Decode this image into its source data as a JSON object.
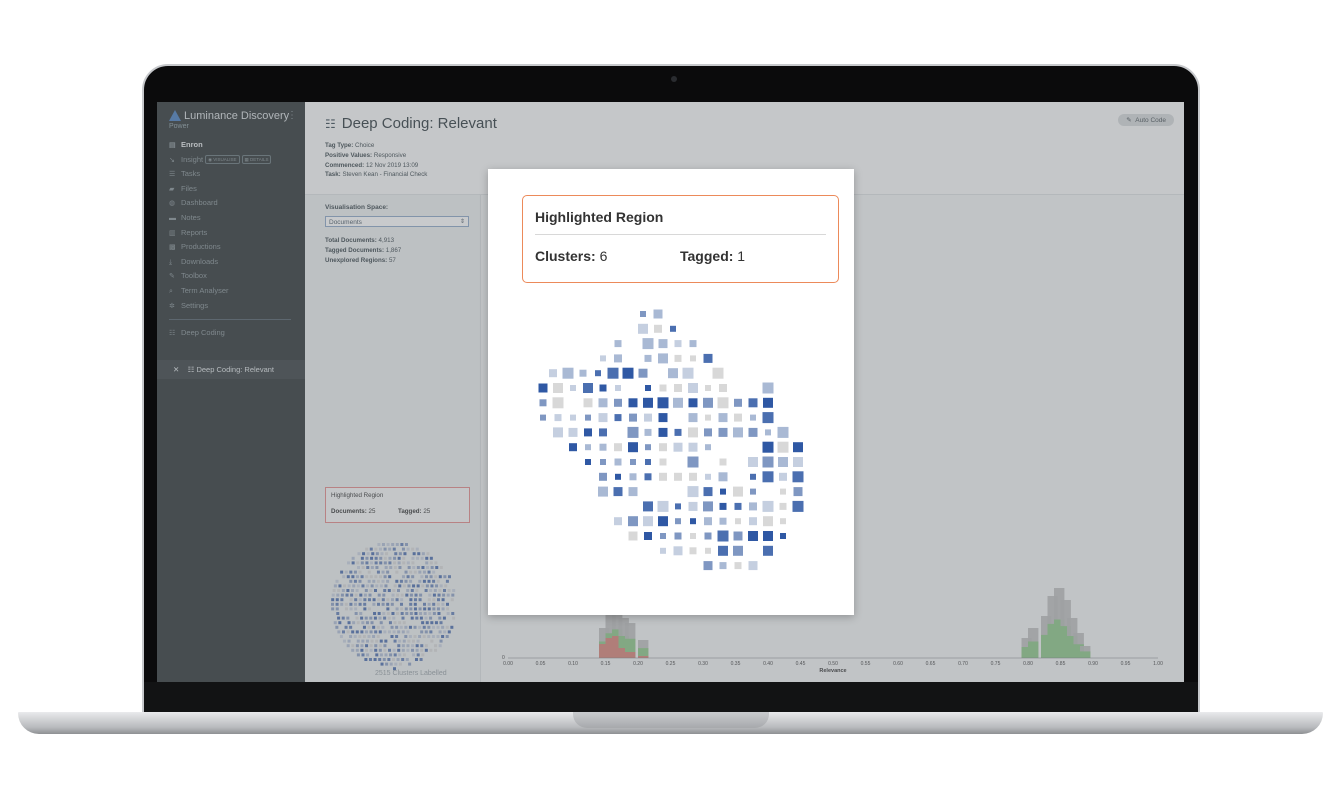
{
  "app": {
    "brand_name": "Luminance Discovery",
    "brand_sub": "Power"
  },
  "sidebar": {
    "items": [
      {
        "label": "Enron",
        "icon": "database-icon",
        "glyph": "▤",
        "active": true
      },
      {
        "label": "Insight",
        "icon": "chart-icon",
        "glyph": "↘",
        "chips": [
          "◉ VISUALISE",
          "▦ DETAILS"
        ]
      },
      {
        "label": "Tasks",
        "icon": "tasks-icon",
        "glyph": "☰"
      },
      {
        "label": "Files",
        "icon": "folder-icon",
        "glyph": "▰"
      },
      {
        "label": "Dashboard",
        "icon": "dashboard-icon",
        "glyph": "◍"
      },
      {
        "label": "Notes",
        "icon": "notes-icon",
        "glyph": "▬"
      },
      {
        "label": "Reports",
        "icon": "reports-icon",
        "glyph": "▥"
      },
      {
        "label": "Productions",
        "icon": "productions-icon",
        "glyph": "▩"
      },
      {
        "label": "Downloads",
        "icon": "download-icon",
        "glyph": "⤓"
      },
      {
        "label": "Toolbox",
        "icon": "wrench-icon",
        "glyph": "✎"
      },
      {
        "label": "Term Analyser",
        "icon": "search-icon",
        "glyph": "⌕"
      },
      {
        "label": "Settings",
        "icon": "gear-icon",
        "glyph": "✲"
      }
    ],
    "deep_coding_label": "Deep Coding",
    "active_task": "Deep Coding: Relevant",
    "close_glyph": "✕",
    "task_glyph": "☷"
  },
  "header": {
    "title": "Deep Coding: Relevant",
    "title_glyph": "☷",
    "tag_type_label": "Tag Type:",
    "tag_type": "Choice",
    "positive_values_label": "Positive Values:",
    "positive_values": "Responsive",
    "commenced_label": "Commenced:",
    "commenced": "12 Nov 2019 13:09",
    "task_label": "Task:",
    "task": "Steven Kean - Financial Check",
    "auto_code": "Auto Code",
    "auto_code_glyph": "✎"
  },
  "left_panel": {
    "visualisation_label": "Visualisation Space:",
    "visualisation_value": "Documents",
    "total_docs_label": "Total Documents:",
    "total_docs": "4,913",
    "tagged_docs_label": "Tagged Documents:",
    "tagged_docs": "1,867",
    "unexplored_label": "Unexplored Regions:",
    "unexplored": "57",
    "hr_title": "Highlighted Region",
    "hr_docs_label": "Documents:",
    "hr_docs": "25",
    "hr_tagged_label": "Tagged:",
    "hr_tagged": "25",
    "footer": "2515 Clusters Labelled"
  },
  "histogram": {
    "xlabel": "Relevance",
    "ticks": [
      "0.00",
      "0.05",
      "0.10",
      "0.15",
      "0.20",
      "0.25",
      "0.30",
      "0.35",
      "0.40",
      "0.45",
      "0.50",
      "0.55",
      "0.60",
      "0.65",
      "0.70",
      "0.75",
      "0.80",
      "0.85",
      "0.90",
      "0.95",
      "1.00"
    ],
    "y_tick": "0",
    "colors": {
      "grey": "#bdbdbd",
      "green": "#8fc98a",
      "red": "#d9857a"
    }
  },
  "modal": {
    "title": "Highlighted Region",
    "clusters_label": "Clusters:",
    "clusters": "6",
    "tagged_label": "Tagged:",
    "tagged": "1",
    "border_color": "#ec8a5a"
  },
  "chart_data": {
    "type": "scatter",
    "palette": [
      "#d8d8d8",
      "#c5cfe0",
      "#a9b9d4",
      "#7f97c2",
      "#4b6fb0",
      "#2f58a4"
    ]
  }
}
